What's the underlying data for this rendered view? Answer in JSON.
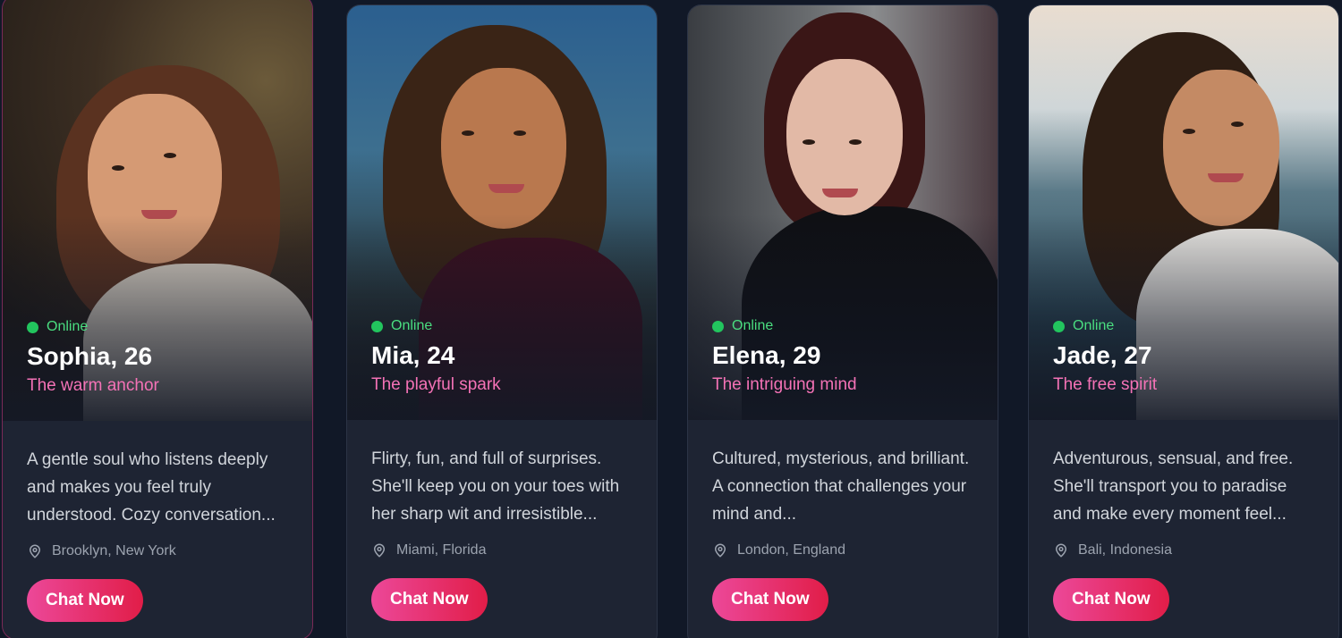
{
  "cards": [
    {
      "status": "Online",
      "name": "Sophia, 26",
      "tagline": "The warm anchor",
      "description": "A gentle soul who listens deeply and makes you feel truly understood. Cozy conversation...",
      "location": "Brooklyn, New York",
      "cta": "Chat Now"
    },
    {
      "status": "Online",
      "name": "Mia, 24",
      "tagline": "The playful spark",
      "description": "Flirty, fun, and full of surprises. She'll keep you on your toes with her sharp wit and irresistible...",
      "location": "Miami, Florida",
      "cta": "Chat Now"
    },
    {
      "status": "Online",
      "name": "Elena, 29",
      "tagline": "The intriguing mind",
      "description": "Cultured, mysterious, and brilliant. A connection that challenges your mind and...",
      "location": "London, England",
      "cta": "Chat Now"
    },
    {
      "status": "Online",
      "name": "Jade, 27",
      "tagline": "The free spirit",
      "description": "Adventurous, sensual, and free. She'll transport you to paradise and make every moment feel...",
      "location": "Bali, Indonesia",
      "cta": "Chat Now"
    }
  ],
  "colors": {
    "online": "#22c55e",
    "tagline": "#f472b6",
    "button_start": "#ec4899",
    "button_end": "#e11d48",
    "card_bg": "#1e2433"
  },
  "icons": {
    "status": "online-dot-icon",
    "location": "map-pin-icon"
  }
}
